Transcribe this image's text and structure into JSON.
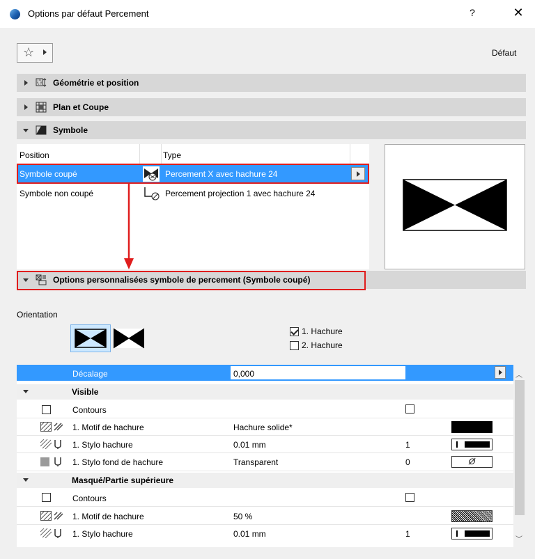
{
  "window": {
    "title": "Options par défaut Percement",
    "help": "?",
    "close": "✕"
  },
  "toolbar": {
    "default_label": "Défaut"
  },
  "panels": {
    "geometry": "Géométrie et position",
    "plan": "Plan et Coupe",
    "symbol": "Symbole",
    "custom": "Options personnalisées symbole de percement (Symbole coupé)"
  },
  "symbol_table": {
    "col_position": "Position",
    "col_type": "Type",
    "rows": [
      {
        "position": "Symbole coupé",
        "type": "Percement X avec hachure 24"
      },
      {
        "position": "Symbole non coupé",
        "type": "Percement projection 1 avec hachure 24"
      }
    ]
  },
  "orientation": {
    "label": "Orientation",
    "hatch1": {
      "label": "1. Hachure",
      "checked": true
    },
    "hatch2": {
      "label": "2. Hachure",
      "checked": false
    }
  },
  "grid": {
    "offset": {
      "label": "Décalage",
      "value": "0,000"
    },
    "visible": {
      "title": "Visible",
      "contours": "Contours",
      "motif": {
        "label": "1. Motif de hachure",
        "value": "Hachure solide*"
      },
      "pen": {
        "label": "1. Stylo hachure",
        "value": "0.01 mm",
        "num": "1"
      },
      "bg_pen": {
        "label": "1. Stylo fond de hachure",
        "value": "Transparent",
        "num": "0",
        "symbol": "Ø"
      }
    },
    "hidden": {
      "title": "Masqué/Partie supérieure",
      "contours": "Contours",
      "motif": {
        "label": "1. Motif de hachure",
        "value": "50 %"
      },
      "pen": {
        "label": "1. Stylo hachure",
        "value": "0.01 mm",
        "num": "1"
      }
    }
  },
  "colors": {
    "selection": "#3399ff",
    "annotation_red": "#e01d1d"
  }
}
